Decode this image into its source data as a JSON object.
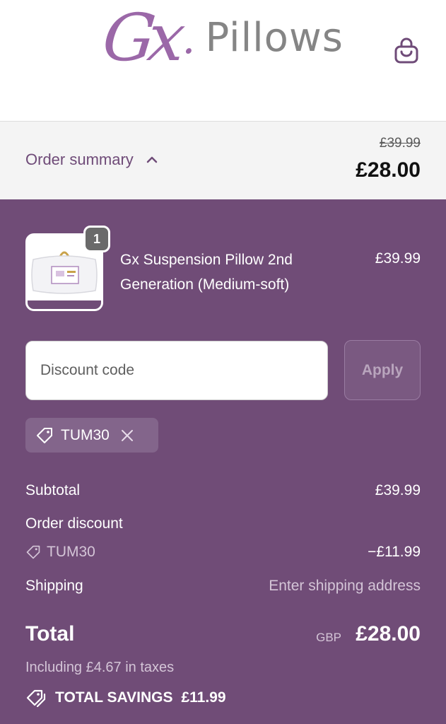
{
  "header": {
    "logo_mark": "Gx",
    "logo_dot": ".",
    "logo_word": "Pillows"
  },
  "summary": {
    "toggle_label": "Order summary",
    "original_total": "£39.99",
    "total": "£28.00"
  },
  "product": {
    "quantity": "1",
    "name": "Gx Suspension Pillow 2nd Generation (Medium-soft)",
    "price": "£39.99"
  },
  "discount": {
    "placeholder": "Discount code",
    "apply_label": "Apply",
    "applied_code": "TUM30"
  },
  "lines": {
    "subtotal_label": "Subtotal",
    "subtotal_value": "£39.99",
    "order_discount_label": "Order discount",
    "order_discount_code": "TUM30",
    "order_discount_value": "−£11.99",
    "shipping_label": "Shipping",
    "shipping_value": "Enter shipping address"
  },
  "total": {
    "label": "Total",
    "currency": "GBP",
    "value": "£28.00",
    "taxes_note": "Including £4.67 in taxes",
    "savings_label": "TOTAL SAVINGS",
    "savings_value": "£11.99"
  },
  "colors": {
    "brand_purple": "#704c77",
    "logo_purple": "#9b68a8",
    "summary_bar": "#f4f4f4"
  }
}
